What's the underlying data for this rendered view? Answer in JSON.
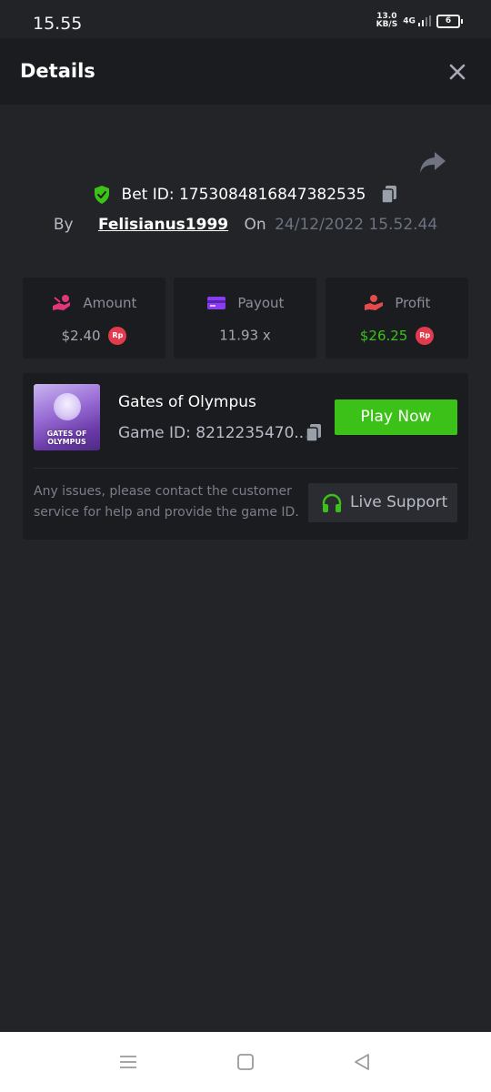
{
  "status_bar": {
    "time": "15.55",
    "net_speed_value": "13.0",
    "net_speed_unit": "KB/S",
    "signal_label": "4G",
    "battery": "6"
  },
  "header": {
    "title": "Details"
  },
  "bet": {
    "id_label": "Bet ID: 1753084816847382535",
    "by_label": "By",
    "username": "Felisianus1999",
    "on_label": "On",
    "date": "24/12/2022 15.52.44"
  },
  "stats": [
    {
      "label": "Amount",
      "value": "$2.40",
      "badge": "Rp"
    },
    {
      "label": "Payout",
      "value": "11.93 x"
    },
    {
      "label": "Profit",
      "value": "$26.25",
      "badge": "Rp"
    }
  ],
  "game": {
    "thumb_text_line1": "GATES OF",
    "thumb_text_line2": "OLYMPUS",
    "title": "Gates of Olympus",
    "id_label": "Game ID: 8212235470...",
    "play_label": "Play Now",
    "help_text": "Any issues, please contact the customer service for help and provide the game ID.",
    "support_label": "Live Support"
  },
  "colors": {
    "accent_green": "#3bc117",
    "badge_red": "#e23b4e",
    "amount_icon": "#e0367a",
    "payout_icon": "#8a3cf0",
    "profit_icon": "#e64a4a"
  }
}
